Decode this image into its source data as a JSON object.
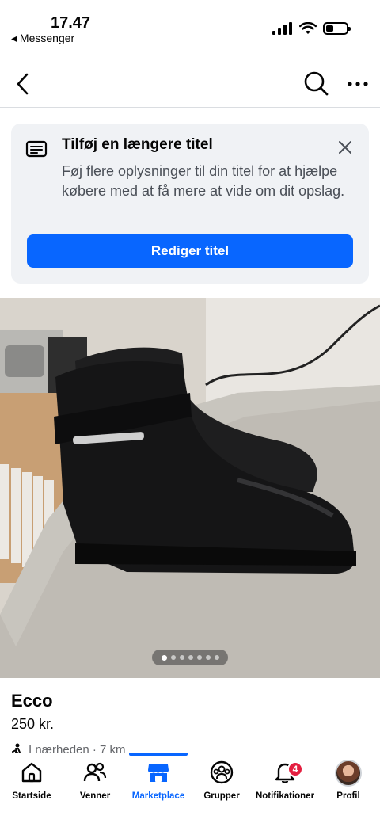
{
  "status_bar": {
    "time": "17.47",
    "back_app": "◂ Messenger"
  },
  "notice": {
    "title": "Tilføj en længere titel",
    "body": "Føj flere oplysninger til din titel for at hjælpe købere med at få mere at vide om dit opslag.",
    "button": "Rediger titel"
  },
  "photo": {
    "image_count": 7,
    "current_index": 1
  },
  "listing": {
    "title": "Ecco",
    "price": "250 kr.",
    "location": "I nærheden · 7 km"
  },
  "tabs": [
    {
      "label": "Startside",
      "icon": "home-icon"
    },
    {
      "label": "Venner",
      "icon": "friends-icon"
    },
    {
      "label": "Marketplace",
      "icon": "marketplace-icon",
      "active": true
    },
    {
      "label": "Grupper",
      "icon": "groups-icon"
    },
    {
      "label": "Notifikationer",
      "icon": "bell-icon",
      "badge": "4"
    },
    {
      "label": "Profil",
      "icon": "avatar"
    }
  ],
  "colors": {
    "accent": "#0866ff",
    "badge": "#e41e3f",
    "card_bg": "#f0f2f5"
  }
}
